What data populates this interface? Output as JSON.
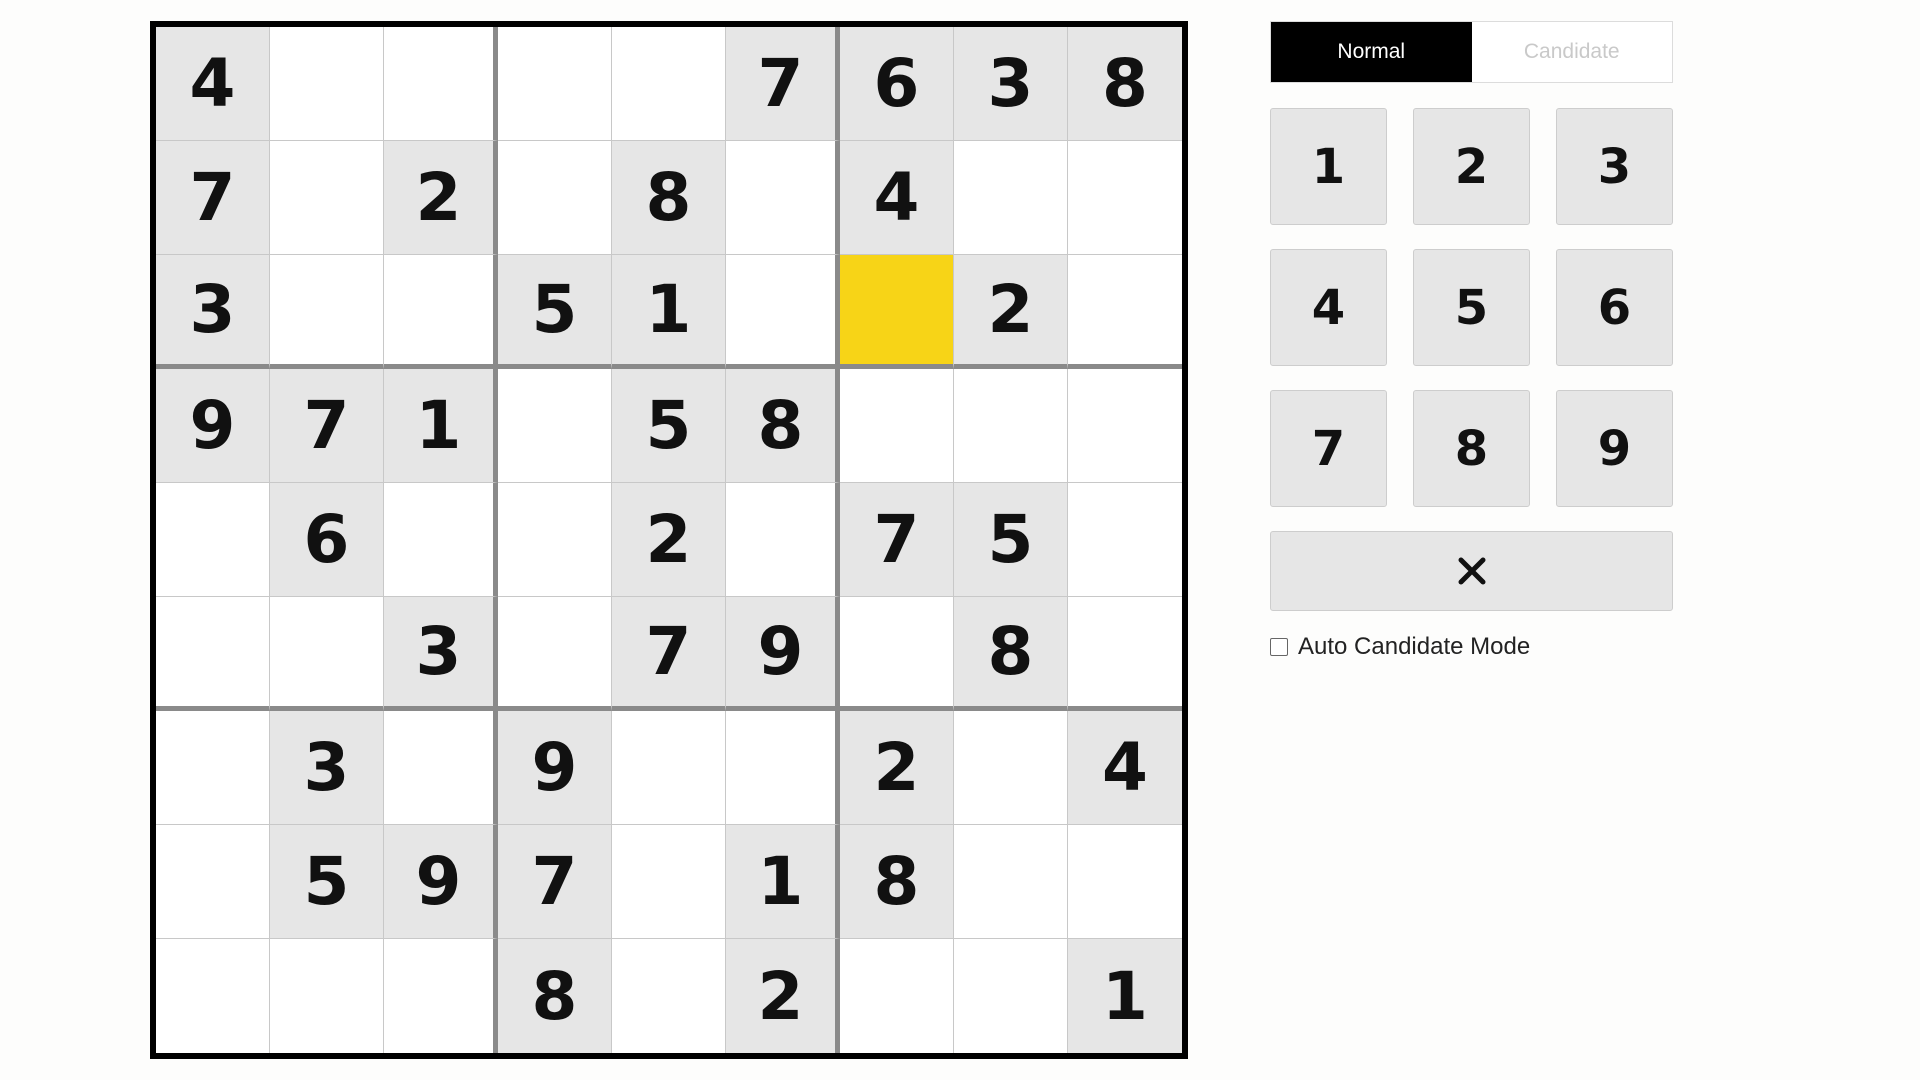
{
  "board": {
    "selected": [
      2,
      6
    ],
    "colors": {
      "given_bg": "#e6e6e6",
      "empty_bg": "#ffffff",
      "selected_bg": "#f7d417"
    },
    "grid": [
      [
        4,
        0,
        0,
        0,
        0,
        7,
        6,
        3,
        8
      ],
      [
        7,
        0,
        2,
        0,
        8,
        0,
        4,
        0,
        0
      ],
      [
        3,
        0,
        0,
        5,
        1,
        0,
        0,
        2,
        0
      ],
      [
        9,
        7,
        1,
        0,
        5,
        8,
        0,
        0,
        0
      ],
      [
        0,
        6,
        0,
        0,
        2,
        0,
        7,
        5,
        0
      ],
      [
        0,
        0,
        3,
        0,
        7,
        9,
        0,
        8,
        0
      ],
      [
        0,
        3,
        0,
        9,
        0,
        0,
        2,
        0,
        4
      ],
      [
        0,
        5,
        9,
        7,
        0,
        1,
        8,
        0,
        0
      ],
      [
        0,
        0,
        0,
        8,
        0,
        2,
        0,
        0,
        1
      ]
    ]
  },
  "mode_toggle": {
    "normal_label": "Normal",
    "candidate_label": "Candidate",
    "active": "normal"
  },
  "numpad": {
    "keys": [
      "1",
      "2",
      "3",
      "4",
      "5",
      "6",
      "7",
      "8",
      "9"
    ],
    "clear_icon": "close-icon"
  },
  "auto_candidate": {
    "label": "Auto Candidate Mode",
    "checked": false
  }
}
